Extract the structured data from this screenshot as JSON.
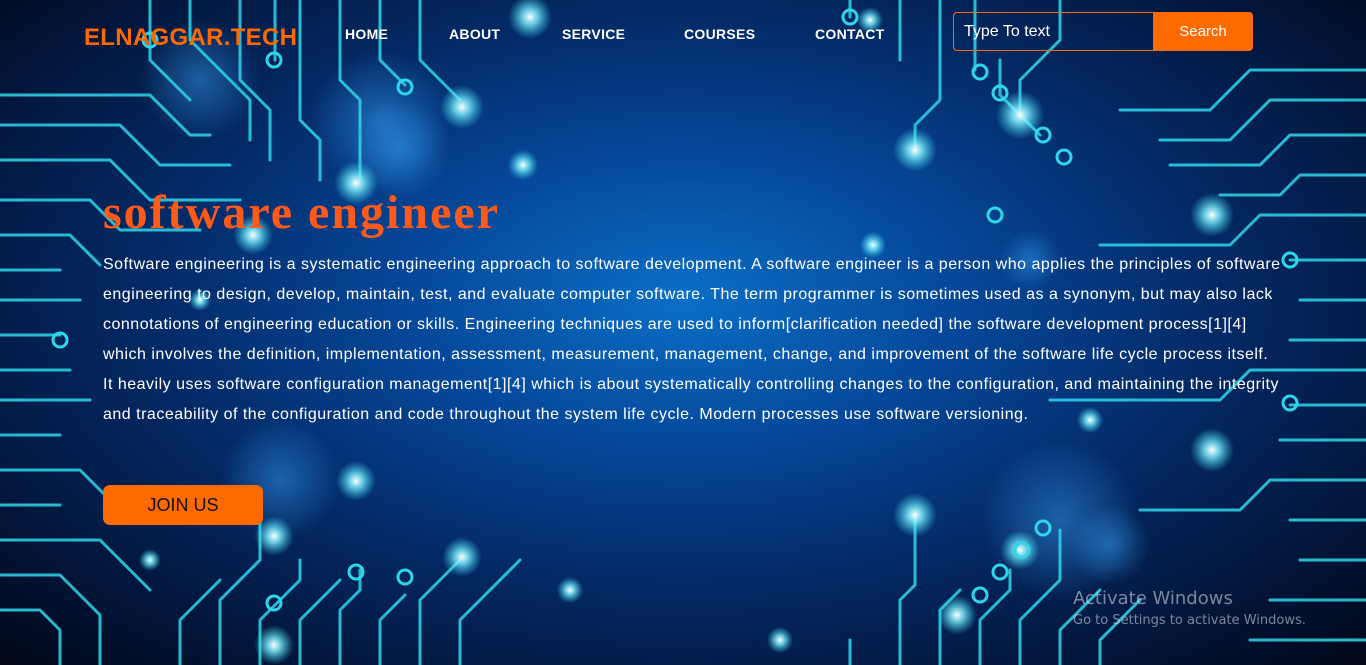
{
  "brand": {
    "logo": "ELNAGGAR.TECH",
    "accent_color": "#ff6a00"
  },
  "nav": {
    "items": [
      {
        "label": "HOME"
      },
      {
        "label": "ABOUT"
      },
      {
        "label": "SERVICE"
      },
      {
        "label": "COURSES"
      },
      {
        "label": "CONTACT"
      }
    ]
  },
  "search": {
    "placeholder": "Type To text",
    "button_label": "Search"
  },
  "hero": {
    "title": "software engineer",
    "description": "Software engineering is a systematic engineering approach to software development. A software engineer is a person who applies the principles of software engineering to design, develop, maintain, test, and evaluate computer software. The term programmer is sometimes used as a synonym, but may also lack connotations of engineering education or skills. Engineering techniques are used to inform[clarification needed] the software development process[1][4] which involves the definition, implementation, assessment, measurement, management, change, and improvement of the software life cycle process itself. It heavily uses software configuration management[1][4] which is about systematically controlling changes to the configuration, and maintaining the integrity and traceability of the configuration and code throughout the system life cycle. Modern processes use software versioning.",
    "cta_label": "JOIN US",
    "title_color": "#ff5a1a"
  },
  "background": {
    "theme": "circuit-board",
    "trace_color": "#2fd6ea"
  },
  "os_watermark": {
    "line1": "Activate Windows",
    "line2": "Go to Settings to activate Windows."
  }
}
